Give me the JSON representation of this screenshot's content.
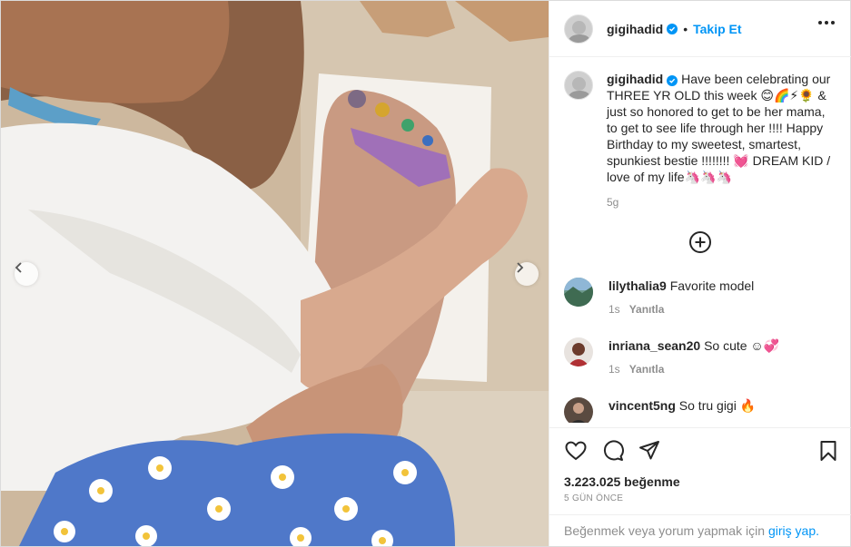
{
  "post": {
    "author": "gigihadid",
    "follow_label": "Takip Et",
    "separator": "•",
    "caption": "Have been celebrating our THREE YR OLD this week 😊🌈⚡🌻 & just so honored to get to be her mama, to get to see life through her !!!! Happy Birthday to my sweetest, smartest, spunkiest bestie !!!!!!!! 💓 DREAM KID / love of my life🦄🦄🦄",
    "caption_age": "5g",
    "likes": "3.223.025 beğenme",
    "date": "5 GÜN ÖNCE"
  },
  "comments": [
    {
      "user": "lilythalia9",
      "text": "Favorite model",
      "age": "1s",
      "reply": "Yanıtla"
    },
    {
      "user": "inriana_sean20",
      "text": "So cute ☺💞",
      "age": "1s",
      "reply": "Yanıtla"
    },
    {
      "user": "vincent5ng",
      "text": "So tru gigi 🔥"
    }
  ],
  "login": {
    "prompt": "Beğenmek veya yorum yapmak için",
    "link": "giriş yap."
  },
  "icons": {
    "more": "more-options-icon",
    "verified": "verified-badge-icon",
    "load_more": "plus-circle-icon",
    "like": "heart-icon",
    "comment": "comment-bubble-icon",
    "share": "paper-plane-icon",
    "save": "bookmark-icon",
    "prev": "chevron-left-icon",
    "next": "chevron-right-icon"
  },
  "colors": {
    "accent": "#0095f6",
    "text": "#262626",
    "muted": "#8e8e8e",
    "border": "#efefef"
  }
}
